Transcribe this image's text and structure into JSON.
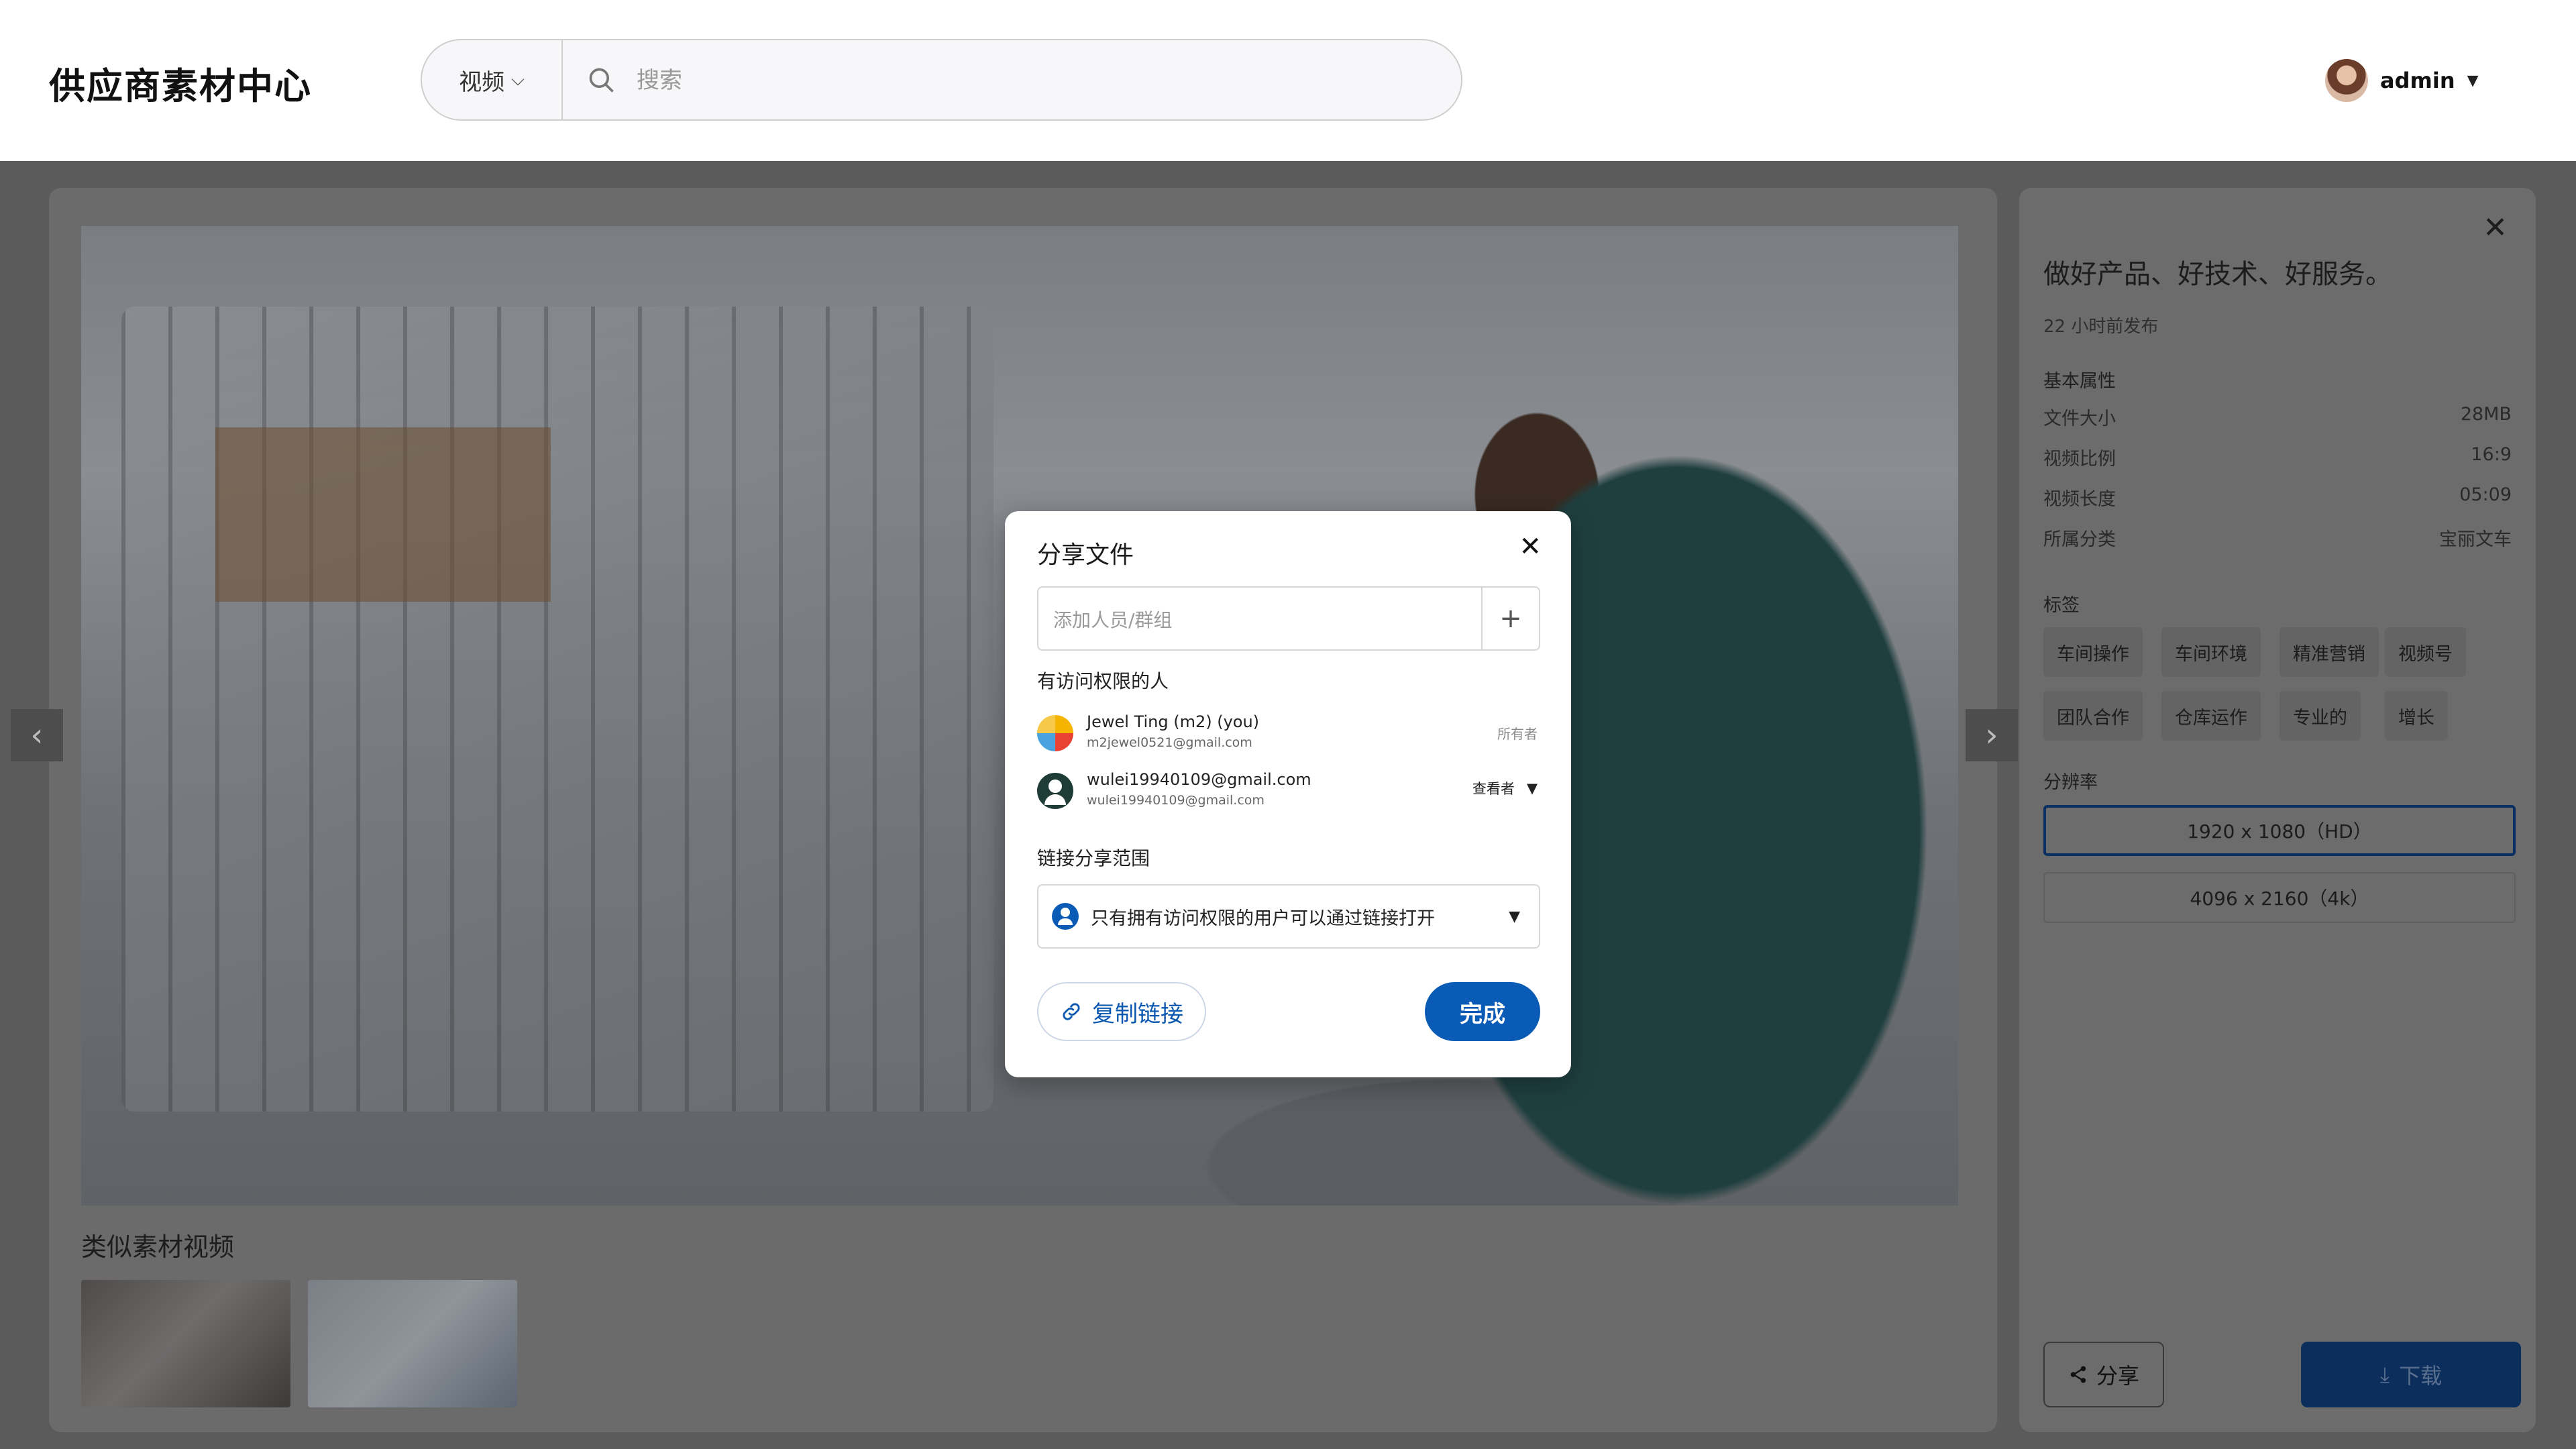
{
  "app": {
    "title": "供应商素材中心"
  },
  "search": {
    "type": "视频",
    "placeholder": "搜索"
  },
  "user": {
    "name": "admin"
  },
  "viewer": {
    "similar_title": "类似素材视频",
    "prev_icon": "chevron-left-icon",
    "next_icon": "chevron-right-icon"
  },
  "panel": {
    "title": "做好产品、好技术、好服务。",
    "published": "22 小时前发布",
    "basic_label": "基本属性",
    "props": [
      {
        "label": "文件大小",
        "value": "28MB"
      },
      {
        "label": "视频比例",
        "value": "16:9"
      },
      {
        "label": "视频长度",
        "value": "05:09"
      },
      {
        "label": "所属分类",
        "value": "宝丽文车"
      }
    ],
    "tags_label": "标签",
    "tags": [
      "车间操作",
      "车间环境",
      "精准营销",
      "视频号",
      "团队合作",
      "仓库运作",
      "专业的",
      "增长"
    ],
    "resolution_label": "分辨率",
    "resolutions": [
      "1920 x 1080（HD）",
      "4096 x 2160（4k）"
    ],
    "share_label": "分享",
    "download_label": "下载"
  },
  "modal": {
    "title": "分享文件",
    "add_placeholder": "添加人员/群组",
    "add_icon": "+",
    "access_label": "有访问权限的人",
    "people": [
      {
        "name": "Jewel Ting (m2) (you)",
        "email": "m2jewel0521@gmail.com",
        "role": "所有者"
      },
      {
        "name": "wulei19940109@gmail.com",
        "email": "wulei19940109@gmail.com",
        "role": "查看者"
      }
    ],
    "link_label": "链接分享范围",
    "link_scope": "只有拥有访问权限的用户可以通过链接打开",
    "copy_label": "复制链接",
    "done_label": "完成"
  },
  "colors": {
    "accent": "#0a5bb5",
    "overlay": "#5b5b5b"
  }
}
